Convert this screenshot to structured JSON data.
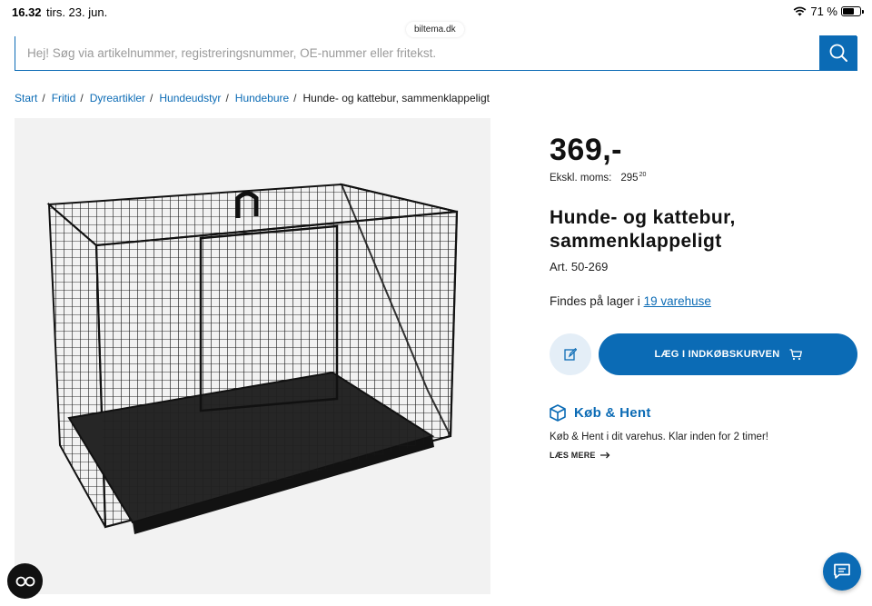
{
  "status_bar": {
    "time": "16.32",
    "date": "tirs. 23. jun.",
    "battery": "71 %",
    "battery_level": 0.71
  },
  "browser": {
    "url": "biltema.dk"
  },
  "search": {
    "placeholder": "Hej! Søg via artikelnummer, registreringsnummer, OE-nummer eller fritekst.",
    "value": "",
    "button_icon": "search-icon"
  },
  "breadcrumb": {
    "items": [
      "Start",
      "Fritid",
      "Dyreartikler",
      "Hundeudstyr",
      "Hundebure"
    ],
    "separator": "/",
    "current": "Hunde- og kattebur, sammenklappeligt"
  },
  "product": {
    "price": "369,-",
    "vat_label": "Ekskl. moms:",
    "vat_int": "295",
    "vat_dec": "20",
    "title": "Hunde- og kattebur, sammenklappeligt",
    "art": "Art. 50-269",
    "stock_prefix": "Findes på lager i ",
    "stock_link": "19 varehuse",
    "image_icon": "dog-cage-image"
  },
  "actions": {
    "note_icon": "edit-icon",
    "cart_label": "LÆG I INDKØBSKURVEN",
    "cart_icon": "cart-icon"
  },
  "kob_hent": {
    "icon": "box-icon",
    "title": "Køb & Hent",
    "description": "Køb & Hent i dit varehus. Klar inden for 2 timer!",
    "more_label": "LÆS MERE",
    "more_icon": "arrow-right-icon"
  },
  "floating": {
    "left_icon": "reader-mode-icon",
    "right_icon": "chat-icon"
  },
  "colors": {
    "brand": "#0b6bb5",
    "brand_light": "#e4eef7",
    "image_bg": "#f2f2f2"
  }
}
